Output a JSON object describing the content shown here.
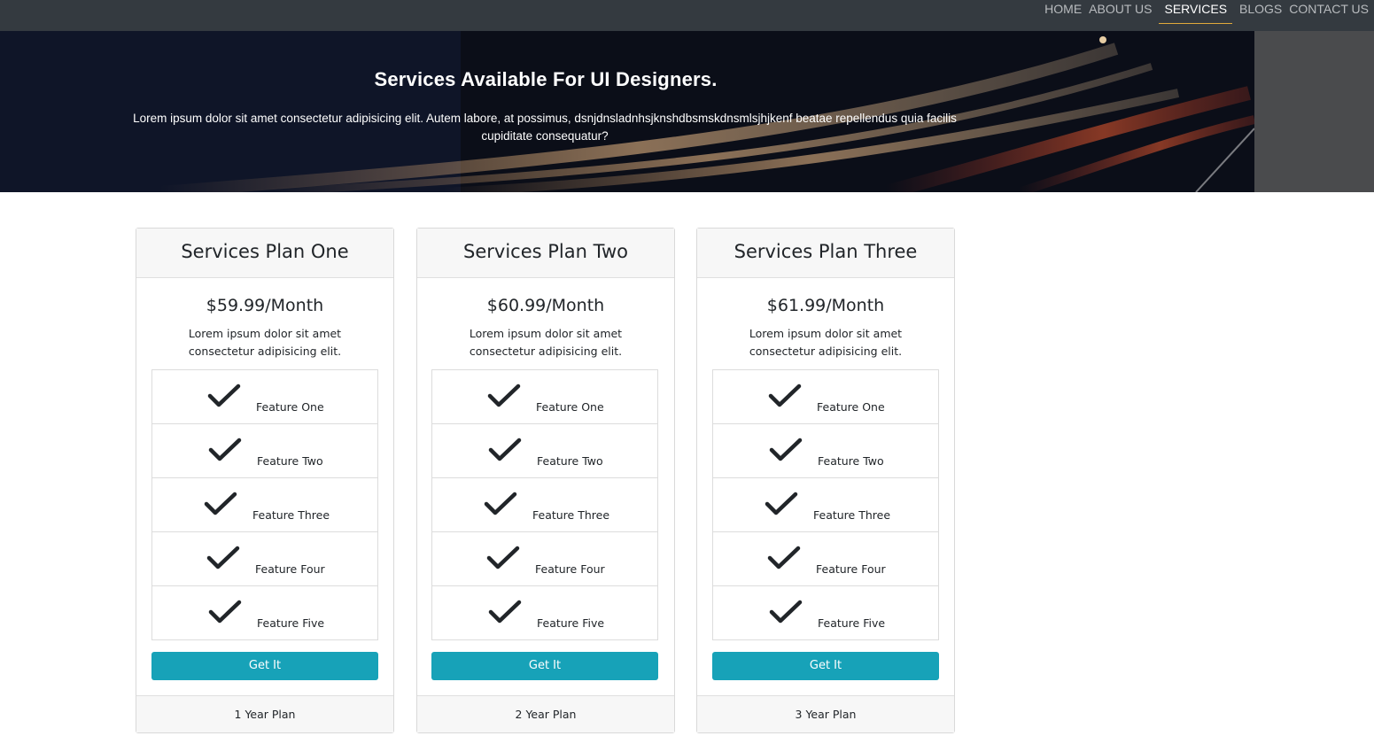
{
  "nav": {
    "items": [
      {
        "label": "HOME",
        "active": false
      },
      {
        "label": "ABOUT US",
        "active": false
      },
      {
        "label": "SERVICES",
        "active": true
      },
      {
        "label": "BLOGS",
        "active": false
      },
      {
        "label": "CONTACT US",
        "active": false
      }
    ]
  },
  "hero": {
    "title": "Services Available For UI Designers.",
    "text": "Lorem ipsum dolor sit amet consectetur adipisicing elit. Autem labore, at possimus, dsnjdnsladnhsjknshdbsmskdnsmlsjhjkenf beatae repellendus quia facilis cupiditate consequatur?"
  },
  "plans": [
    {
      "title": "Services Plan One",
      "price": "$59.99/Month",
      "description": "Lorem ipsum dolor sit amet consectetur adipisicing elit.",
      "features": [
        "Feature One",
        "Feature Two",
        "Feature Three",
        "Feature Four",
        "Feature Five"
      ],
      "button": "Get It",
      "footer": "1 Year Plan"
    },
    {
      "title": "Services Plan Two",
      "price": "$60.99/Month",
      "description": "Lorem ipsum dolor sit amet consectetur adipisicing elit.",
      "features": [
        "Feature One",
        "Feature Two",
        "Feature Three",
        "Feature Four",
        "Feature Five"
      ],
      "button": "Get It",
      "footer": "2 Year Plan"
    },
    {
      "title": "Services Plan Three",
      "price": "$61.99/Month",
      "description": "Lorem ipsum dolor sit amet consectetur adipisicing elit.",
      "features": [
        "Feature One",
        "Feature Two",
        "Feature Three",
        "Feature Four",
        "Feature Five"
      ],
      "button": "Get It",
      "footer": "3 Year Plan"
    }
  ],
  "colors": {
    "navbar": "#343a40",
    "accent": "#17a2b8",
    "nav_active_underline": "#e0a93c"
  },
  "icons": {
    "feature": "check-icon"
  }
}
